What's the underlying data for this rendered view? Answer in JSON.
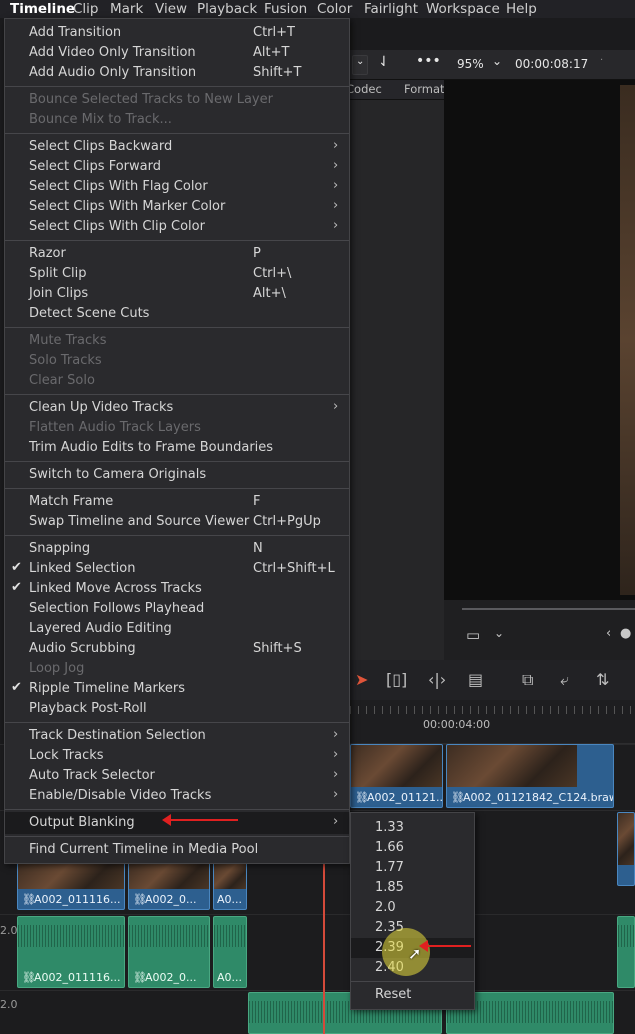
{
  "menubar": [
    "Timeline",
    "Clip",
    "Mark",
    "View",
    "Playback",
    "Fusion",
    "Color",
    "Fairlight",
    "Workspace",
    "Help"
  ],
  "viewer": {
    "zoom": "95%",
    "timecode": "00:00:08:17"
  },
  "media_pool": {
    "columns": [
      "Codec",
      "Format"
    ]
  },
  "ruler": {
    "timecode": "00:00:04:00"
  },
  "tracks": {
    "v_label": "2.0",
    "a_label": "2.0"
  },
  "clips": {
    "video_top": [
      "A002_01121...",
      "A002_01121842_C124.braw"
    ],
    "video_v1": [
      "A002_011116...",
      "A002_0...",
      "A0..."
    ],
    "audio_a1": [
      "A002_011116...",
      "A002_0...",
      "A0..."
    ]
  },
  "menu": {
    "items": [
      {
        "label": "Add Transition",
        "shortcut": "Ctrl+T"
      },
      {
        "label": "Add Video Only Transition",
        "shortcut": "Alt+T"
      },
      {
        "label": "Add Audio Only Transition",
        "shortcut": "Shift+T"
      },
      {
        "label": "Bounce Selected Tracks to New Layer",
        "disabled": true
      },
      {
        "label": "Bounce Mix to Track...",
        "disabled": true
      },
      {
        "label": "Select Clips Backward",
        "submenu": true
      },
      {
        "label": "Select Clips Forward",
        "submenu": true
      },
      {
        "label": "Select Clips With Flag Color",
        "submenu": true
      },
      {
        "label": "Select Clips With Marker Color",
        "submenu": true
      },
      {
        "label": "Select Clips With Clip Color",
        "submenu": true
      },
      {
        "label": "Razor",
        "shortcut": "P"
      },
      {
        "label": "Split Clip",
        "shortcut": "Ctrl+\\"
      },
      {
        "label": "Join Clips",
        "shortcut": "Alt+\\"
      },
      {
        "label": "Detect Scene Cuts"
      },
      {
        "label": "Mute Tracks",
        "disabled": true
      },
      {
        "label": "Solo Tracks",
        "disabled": true
      },
      {
        "label": "Clear Solo",
        "disabled": true
      },
      {
        "label": "Clean Up Video Tracks",
        "submenu": true
      },
      {
        "label": "Flatten Audio Track Layers",
        "disabled": true
      },
      {
        "label": "Trim Audio Edits to Frame Boundaries"
      },
      {
        "label": "Switch to Camera Originals"
      },
      {
        "label": "Match Frame",
        "shortcut": "F"
      },
      {
        "label": "Swap Timeline and Source Viewer",
        "shortcut": "Ctrl+PgUp"
      },
      {
        "label": "Snapping",
        "shortcut": "N"
      },
      {
        "label": "Linked Selection",
        "shortcut": "Ctrl+Shift+L",
        "checked": true
      },
      {
        "label": "Linked Move Across Tracks",
        "checked": true
      },
      {
        "label": "Selection Follows Playhead"
      },
      {
        "label": "Layered Audio Editing"
      },
      {
        "label": "Audio Scrubbing",
        "shortcut": "Shift+S"
      },
      {
        "label": "Loop Jog",
        "disabled": true
      },
      {
        "label": "Ripple Timeline Markers",
        "checked": true
      },
      {
        "label": "Playback Post-Roll"
      },
      {
        "label": "Track Destination Selection",
        "submenu": true
      },
      {
        "label": "Lock Tracks",
        "submenu": true
      },
      {
        "label": "Auto Track Selector",
        "submenu": true
      },
      {
        "label": "Enable/Disable Video Tracks",
        "submenu": true
      },
      {
        "label": "Output Blanking",
        "submenu": true,
        "highlighted": true
      },
      {
        "label": "Find Current Timeline in Media Pool"
      }
    ]
  },
  "submenu": {
    "items": [
      "1.33",
      "1.66",
      "1.77",
      "1.85",
      "2.0",
      "2.35",
      "2.39",
      "2.40"
    ],
    "highlighted": "2.39",
    "reset": "Reset"
  },
  "colors": {
    "accent_arrow": "#e02020",
    "video_clip": "#2d5f8f",
    "audio_clip": "#2f8a68",
    "playhead": "#d44a3a"
  }
}
